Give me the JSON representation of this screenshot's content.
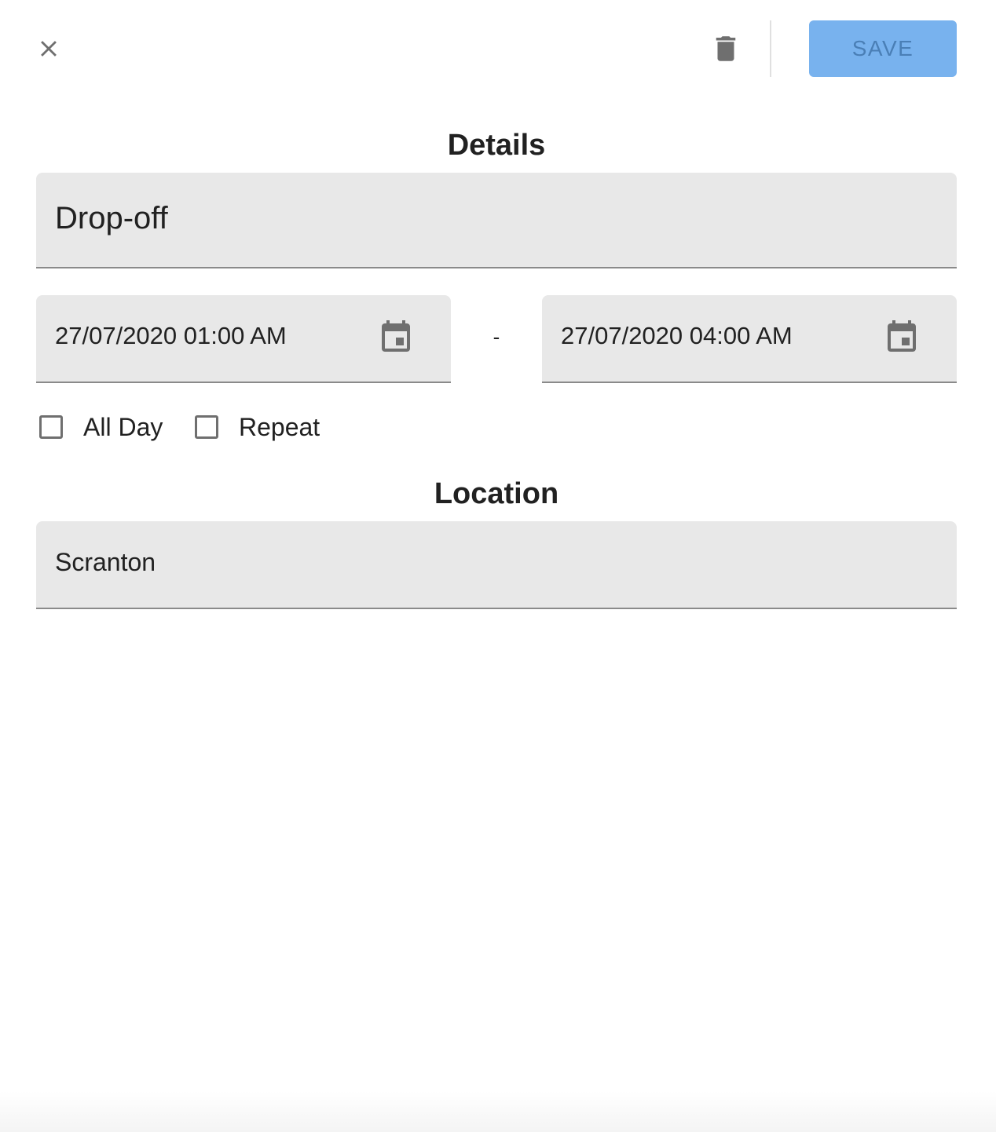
{
  "toolbar": {
    "close_icon": "close-icon",
    "delete_icon": "trash-icon",
    "save_label": "SAVE",
    "save_color": "#78b2ee"
  },
  "details": {
    "heading": "Details",
    "title_value": "Drop-off",
    "start_datetime": "27/07/2020 01:00 AM",
    "separator": "-",
    "end_datetime": "27/07/2020 04:00 AM",
    "calendar_icon": "calendar-icon",
    "all_day": {
      "label": "All Day",
      "checked": false
    },
    "repeat": {
      "label": "Repeat",
      "checked": false
    }
  },
  "location": {
    "heading": "Location",
    "value": "Scranton"
  }
}
